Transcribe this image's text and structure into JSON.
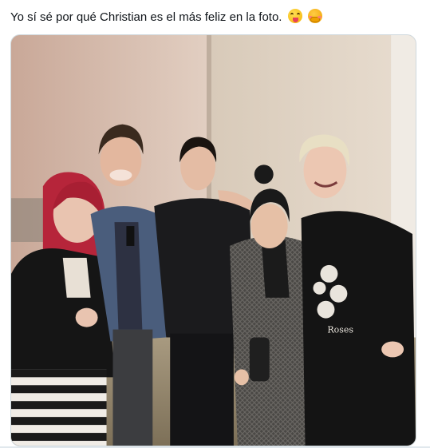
{
  "post": {
    "text": "Yo sí sé por qué Christian es el más feliz en la foto.",
    "emojis": [
      "face-with-tongue-icon",
      "blushing-face-icon"
    ]
  },
  "media": {
    "type": "photo",
    "shirt_text": "Roses"
  },
  "colors": {
    "text": "#0f1419",
    "border": "#cfd9de",
    "background": "#ffffff"
  }
}
